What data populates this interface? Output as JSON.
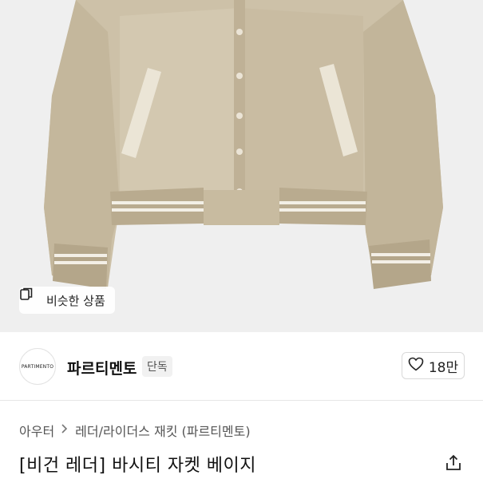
{
  "hero": {
    "image_description": "beige leather varsity jacket product photo",
    "similar_button_label": "비슷한 상품"
  },
  "brand": {
    "logo_text": "PARTIMENTO",
    "name": "파르티멘토",
    "badge": "단독",
    "likes": "18만"
  },
  "breadcrumb": {
    "category": "아우터",
    "subcategory": "레더/라이더스 재킷 (파르티멘토)"
  },
  "product": {
    "title": "[비건 레더] 바시티 자켓 베이지"
  },
  "colors": {
    "jacket": "#cfc3ab",
    "background": "#efefef",
    "text": "#222222"
  }
}
